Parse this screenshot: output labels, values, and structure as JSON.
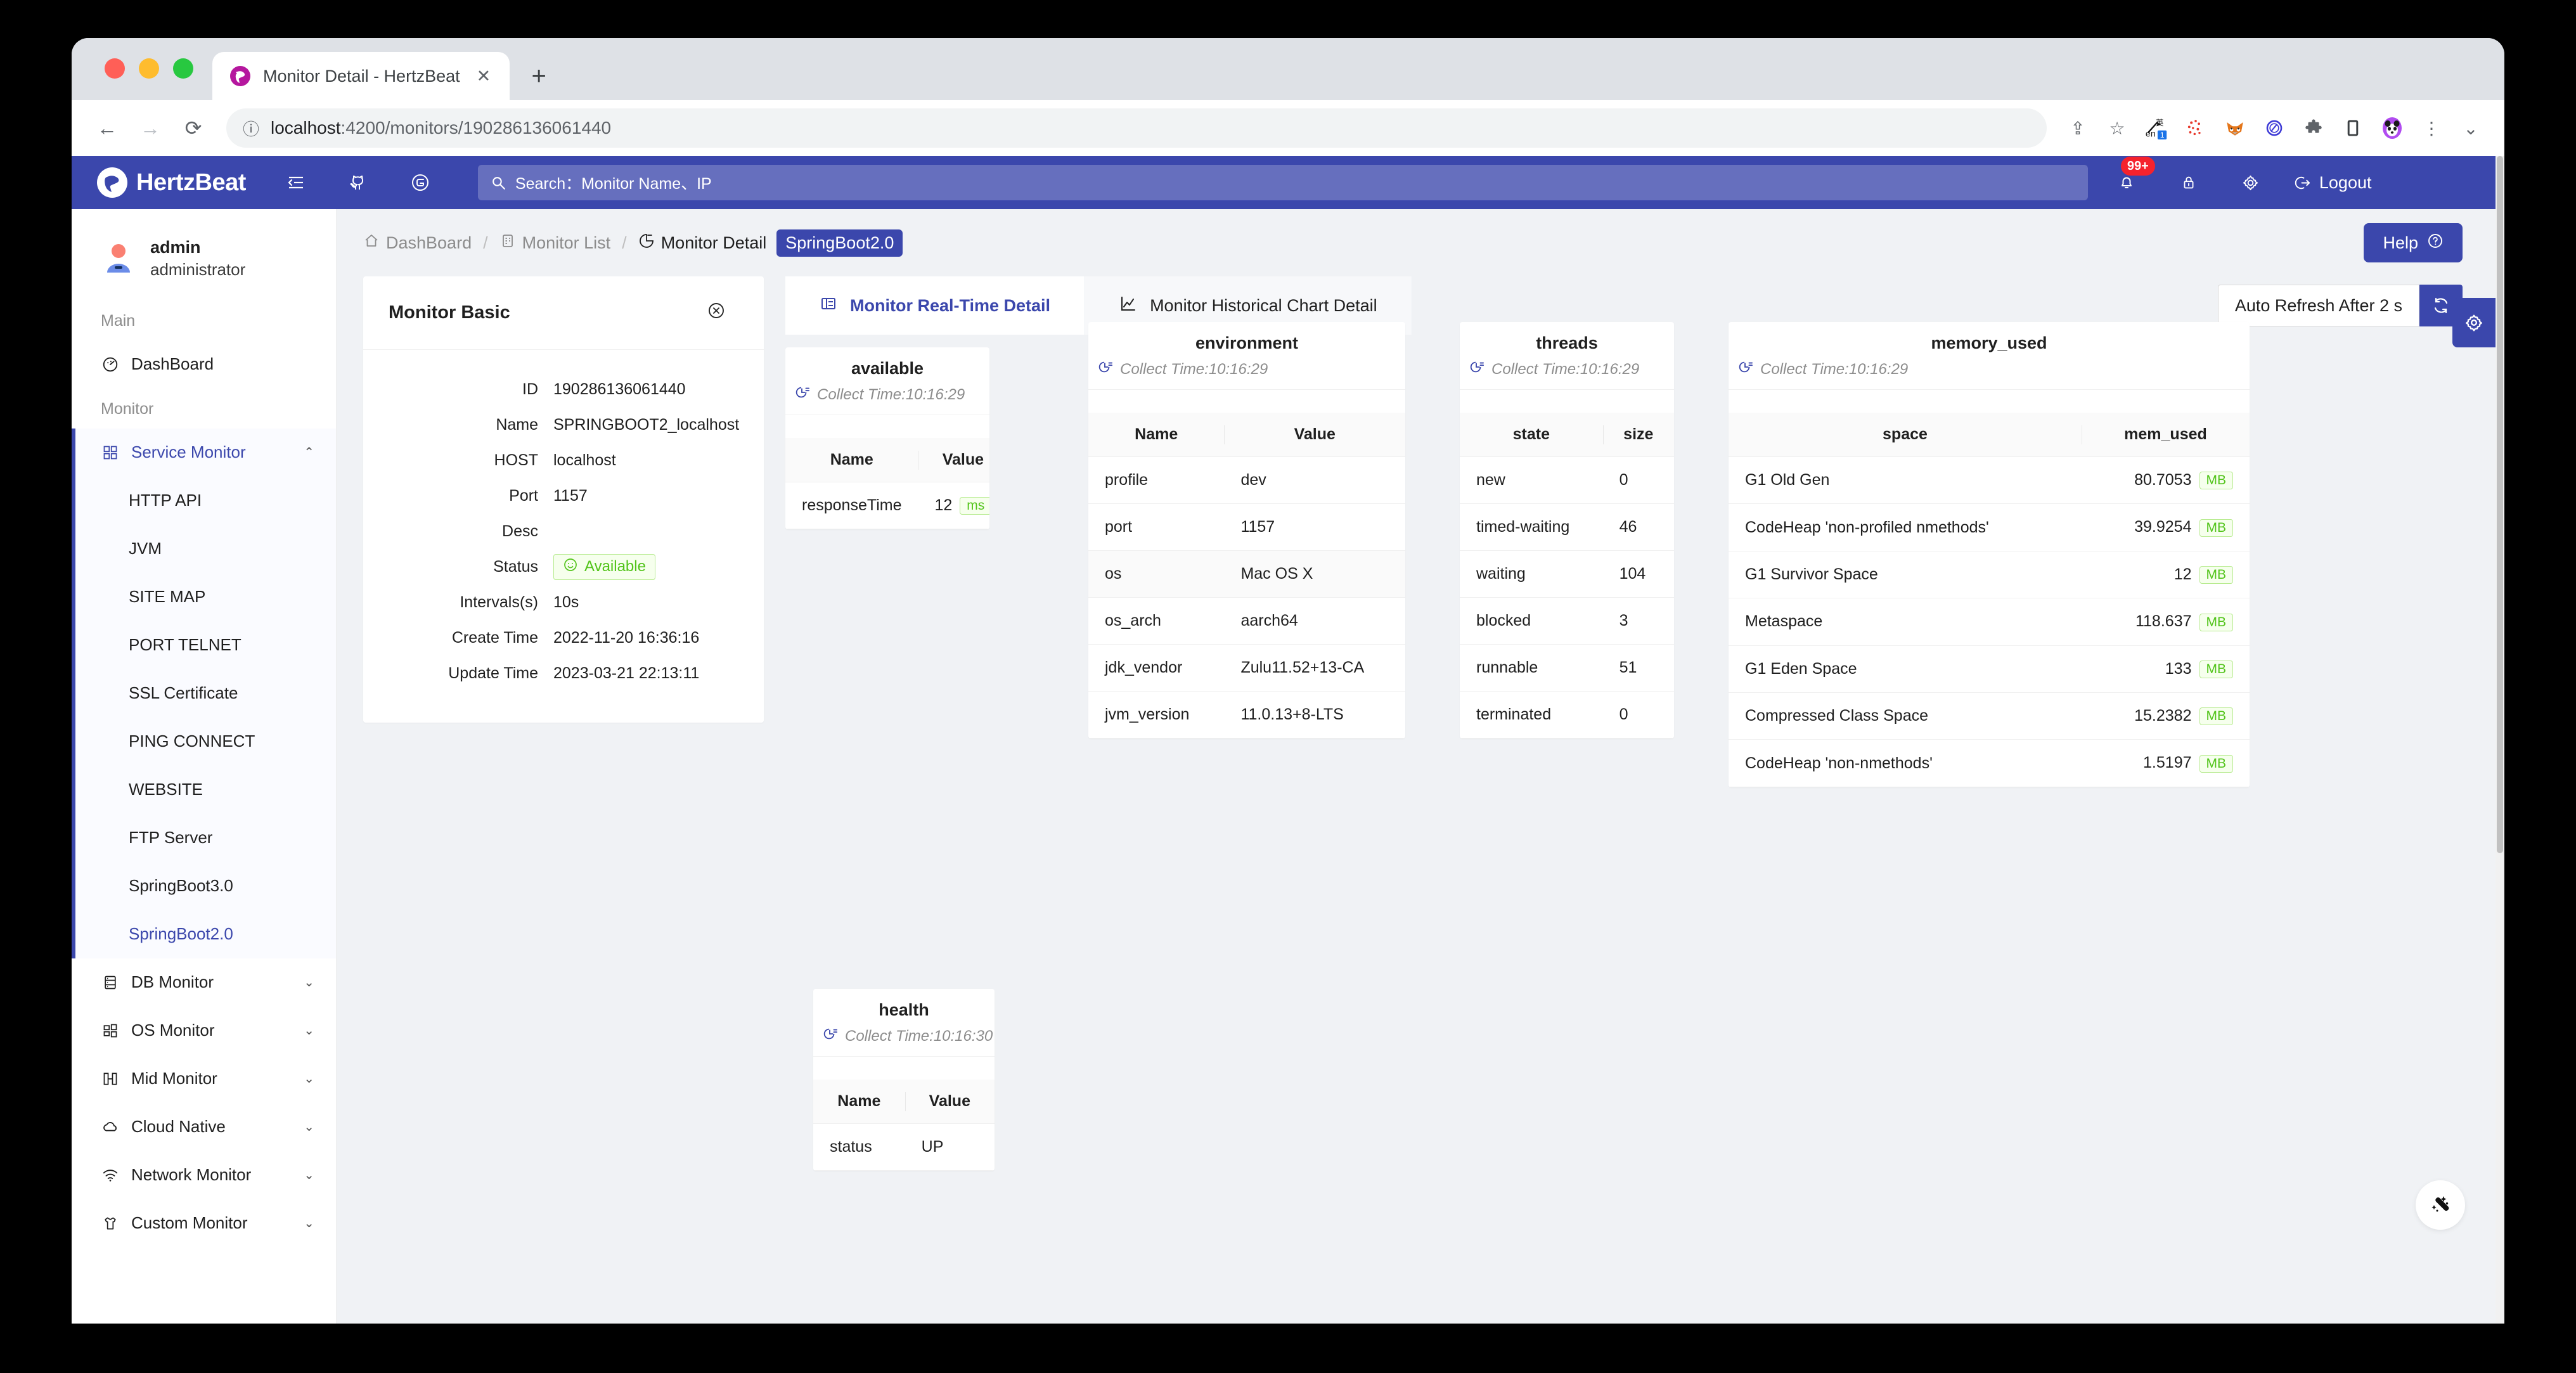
{
  "browser": {
    "tab_title": "Monitor Detail - HertzBeat",
    "tab_close_glyph": "✕",
    "new_tab_glyph": "+",
    "back_glyph": "←",
    "forward_glyph": "→",
    "reload_glyph": "⟳",
    "info_glyph": "ⓘ",
    "url_host": "localhost",
    "url_path": ":4200/monitors/190286136061440",
    "share_glyph": "⇪",
    "bookmark_glyph": "☆",
    "menu_glyph": "⋮",
    "ext_badge": "1",
    "window_collapse_glyph": "⌄"
  },
  "header": {
    "brand": "HertzBeat",
    "menu_collapse_icon": "menu-collapse-icon",
    "github_icon": "github-icon",
    "gitee_icon": "gitee-icon",
    "search_placeholder": "Search：Monitor Name、IP",
    "notification_badge": "99+",
    "lock_icon": "lock-icon",
    "gear_icon": "gear-icon",
    "logout_label": "Logout",
    "accent_color": "#3b47ac"
  },
  "sidebar": {
    "user": {
      "name": "admin",
      "role": "administrator"
    },
    "groups": [
      {
        "title": "Main"
      },
      {
        "title": "Monitor"
      }
    ],
    "main_items": [
      {
        "label": "DashBoard",
        "icon": "dashboard-icon"
      }
    ],
    "service_monitor": {
      "label": "Service Monitor",
      "icon": "grid-icon",
      "chevron": "⌃",
      "children": [
        {
          "label": "HTTP API"
        },
        {
          "label": "JVM"
        },
        {
          "label": "SITE MAP"
        },
        {
          "label": "PORT TELNET"
        },
        {
          "label": "SSL Certificate"
        },
        {
          "label": "PING CONNECT"
        },
        {
          "label": "WEBSITE"
        },
        {
          "label": "FTP Server"
        },
        {
          "label": "SpringBoot3.0"
        },
        {
          "label": "SpringBoot2.0"
        }
      ],
      "selected_child": "SpringBoot2.0"
    },
    "collapsed_groups": [
      {
        "label": "DB Monitor",
        "icon": "database-icon",
        "chevron": "⌄"
      },
      {
        "label": "OS Monitor",
        "icon": "windows-icon",
        "chevron": "⌄"
      },
      {
        "label": "Mid Monitor",
        "icon": "middleware-icon",
        "chevron": "⌄"
      },
      {
        "label": "Cloud Native",
        "icon": "cloud-icon",
        "chevron": "⌄"
      },
      {
        "label": "Network Monitor",
        "icon": "wifi-icon",
        "chevron": "⌄"
      },
      {
        "label": "Custom Monitor",
        "icon": "shirt-icon",
        "chevron": "⌄"
      }
    ]
  },
  "breadcrumb": {
    "items": [
      {
        "label": "DashBoard",
        "icon": "home-icon"
      },
      {
        "label": "Monitor List",
        "icon": "clipboard-icon"
      },
      {
        "label": "Monitor Detail",
        "icon": "pie-clock-icon"
      }
    ],
    "separator": "/",
    "tag": "SpringBoot2.0",
    "help_label": "Help",
    "help_icon": "question-circle-icon"
  },
  "basic_card": {
    "title": "Monitor Basic",
    "close_icon": "close-circle-icon",
    "rows": [
      {
        "key": "ID",
        "value": "190286136061440"
      },
      {
        "key": "Name",
        "value": "SPRINGBOOT2_localhost"
      },
      {
        "key": "HOST",
        "value": "localhost"
      },
      {
        "key": "Port",
        "value": "1157"
      },
      {
        "key": "Desc",
        "value": ""
      },
      {
        "key": "Status",
        "value": "Available",
        "type": "tag",
        "tag_icon": "smile-icon"
      },
      {
        "key": "Intervals(s)",
        "value": "10s"
      },
      {
        "key": "Create Time",
        "value": "2022-11-20 16:36:16"
      },
      {
        "key": "Update Time",
        "value": "2023-03-21 22:13:11"
      }
    ]
  },
  "tabs": [
    {
      "label": "Monitor Real-Time Detail",
      "icon": "detail-list-icon",
      "active": true
    },
    {
      "label": "Monitor Historical Chart Detail",
      "icon": "line-chart-icon",
      "active": false
    }
  ],
  "refresh": {
    "value": "Auto Refresh After 2 s",
    "button_icon": "refresh-icon"
  },
  "metrics": [
    {
      "name": "available",
      "collect_time": "Collect Time:10:16:29",
      "columns": [
        "Name",
        "Value"
      ],
      "rows": [
        {
          "c0": "responseTime",
          "c1": "12",
          "unit": "ms"
        }
      ]
    },
    {
      "name": "environment",
      "collect_time": "Collect Time:10:16:29",
      "columns": [
        "Name",
        "Value"
      ],
      "rows": [
        {
          "c0": "profile",
          "c1": "dev"
        },
        {
          "c0": "port",
          "c1": "1157"
        },
        {
          "c0": "os",
          "c1": "Mac OS X"
        },
        {
          "c0": "os_arch",
          "c1": "aarch64"
        },
        {
          "c0": "jdk_vendor",
          "c1": "Zulu11.52+13-CA"
        },
        {
          "c0": "jvm_version",
          "c1": "11.0.13+8-LTS"
        }
      ]
    },
    {
      "name": "threads",
      "collect_time": "Collect Time:10:16:29",
      "columns": [
        "state",
        "size"
      ],
      "rows": [
        {
          "c0": "new",
          "c1": "0"
        },
        {
          "c0": "timed-waiting",
          "c1": "46"
        },
        {
          "c0": "waiting",
          "c1": "104"
        },
        {
          "c0": "blocked",
          "c1": "3"
        },
        {
          "c0": "runnable",
          "c1": "51"
        },
        {
          "c0": "terminated",
          "c1": "0"
        }
      ]
    },
    {
      "name": "memory_used",
      "collect_time": "Collect Time:10:16:29",
      "columns": [
        "space",
        "mem_used"
      ],
      "rows": [
        {
          "c0": "G1 Old Gen",
          "c1": "80.7053",
          "unit": "MB"
        },
        {
          "c0": "CodeHeap 'non-profiled nmethods'",
          "c1": "39.9254",
          "unit": "MB"
        },
        {
          "c0": "G1 Survivor Space",
          "c1": "12",
          "unit": "MB"
        },
        {
          "c0": "Metaspace",
          "c1": "118.637",
          "unit": "MB"
        },
        {
          "c0": "G1 Eden Space",
          "c1": "133",
          "unit": "MB"
        },
        {
          "c0": "Compressed Class Space",
          "c1": "15.2382",
          "unit": "MB"
        },
        {
          "c0": "CodeHeap 'non-nmethods'",
          "c1": "1.5197",
          "unit": "MB"
        }
      ]
    },
    {
      "name": "health",
      "collect_time": "Collect Time:10:16:30",
      "columns": [
        "Name",
        "Value"
      ],
      "rows": [
        {
          "c0": "status",
          "c1": "UP"
        }
      ]
    }
  ],
  "float_gear_icon": "settings-gear-icon",
  "magic_cursor_icon": "magic-wand-icon"
}
